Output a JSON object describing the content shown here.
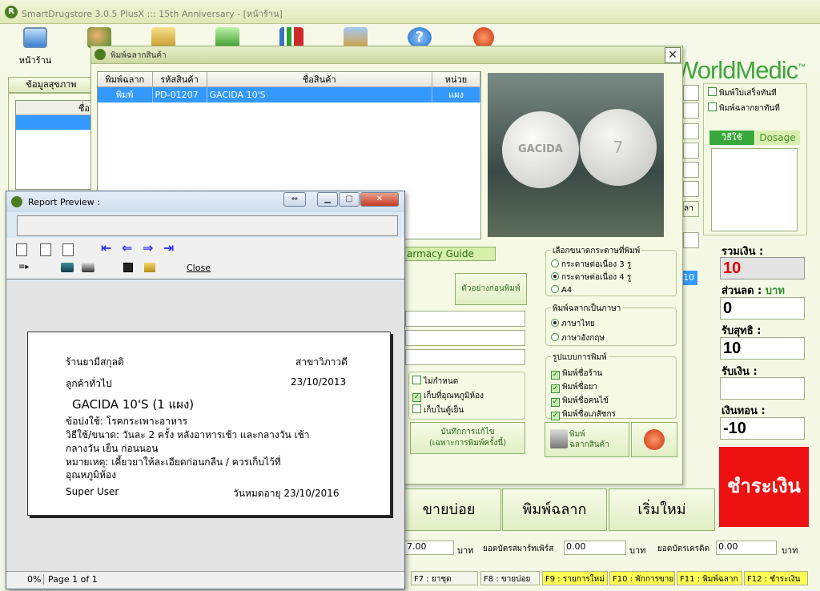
{
  "app": {
    "title": "SmartDrugstore 3.0.5 PlusX ::: 15th Anniversary - [หน้าร้าน]",
    "brand": "WorldMedic",
    "brand_tm": "™"
  },
  "toolbar": {
    "items": [
      {
        "label": "หน้าร้าน",
        "icon": "computer-icon"
      },
      {
        "label": "",
        "icon": "users-icon"
      },
      {
        "label": "",
        "icon": "box-icon"
      },
      {
        "label": "",
        "icon": "refresh-icon"
      },
      {
        "label": "",
        "icon": "chart-icon"
      },
      {
        "label": "",
        "icon": "tools-icon"
      },
      {
        "label": "",
        "icon": "help-icon"
      },
      {
        "label": "",
        "icon": "power-icon"
      }
    ]
  },
  "main": {
    "tab_health": "ข้อมูลสุขภาพ",
    "name_col": "ชื่อ",
    "pharmacy_guide": "armacy Guide",
    "preview_btn": "ตัวอย่างก่อนพิมพ์",
    "checks": [
      {
        "label": "ไม่กำหนด",
        "on": false
      },
      {
        "label": "เก็บที่อุณหภูมิห้อง",
        "on": true
      },
      {
        "label": "เก็บในตู้เย็น",
        "on": false
      }
    ],
    "save_btn_l1": "บันทึกการแก้ไข",
    "save_btn_l2": "(เฉพาะการพิมพ์ครั้งนี้)",
    "right_checks": [
      {
        "label": "พิมพ์ใบเสร็จทันที"
      },
      {
        "label": "พิมพ์ฉลากยาทันที"
      }
    ],
    "tab_howto": "วิธีใช้",
    "tab_dosage": "Dosage",
    "cell_10": "10",
    "cell_la": "ลา",
    "total_label": "รวมเงิน :",
    "total_value": "10",
    "discount_label": "ส่วนลด :",
    "discount_unit": "บาท",
    "discount_value": "0",
    "net_label": "รับสุทธิ :",
    "net_value": "10",
    "received_label": "รับเงิน :",
    "received_value": "",
    "change_label": "เงินทอน :",
    "change_value": "-10",
    "pay_btn": "ชำระเงิน",
    "btn_sell": "ขายบ่อย",
    "btn_print": "พิมพ์ฉลาก",
    "btn_new": "เริ่มใหม่",
    "bottom": {
      "v1": "7.00",
      "u1": "บาท",
      "l2": "ยอดบัตรสมาร์ทเพิร์ส",
      "v2": "0.00",
      "u2": "บาท",
      "l3": "ยอดบัตรเครดิต",
      "v3": "0.00",
      "u3": "บาท"
    },
    "fkeys": [
      "F7 : ยาชุด",
      "F8 : ขายบ่อย",
      "F9 : รายการใหม่",
      "F10 : พักการขาย",
      "F11 : พิมพ์ฉลาก",
      "F12 : ชำระเงิน"
    ]
  },
  "dialog": {
    "title": "พิมพ์ฉลากสินค้า",
    "columns": [
      "พิมพ์ฉลาก",
      "รหัสสินค้า",
      "ชื่อสินค้า",
      "หน่วย"
    ],
    "rows": [
      {
        "print": "พิมพ์",
        "code": "PD-01207",
        "name": "GACIDA 10'S",
        "unit": "แผง"
      }
    ],
    "image_text_l": "GACIDA",
    "image_text_r": "7",
    "paper_title": "เลือกขนาดกระดาษที่พิมพ์",
    "paper": [
      {
        "label": "กระดาษต่อเนื่อง 3 รู",
        "on": false
      },
      {
        "label": "กระดาษต่อเนื่อง 4 รู",
        "on": true
      },
      {
        "label": "A4",
        "on": false
      }
    ],
    "lang_title": "พิมพ์ฉลากเป็นภาษา",
    "lang": [
      {
        "label": "ภาษาไทย",
        "on": true
      },
      {
        "label": "ภาษาอังกฤษ",
        "on": false
      }
    ],
    "format_title": "รูปแบบการพิมพ์",
    "format": [
      {
        "label": "พิมพ์ชื่อร้าน",
        "on": true
      },
      {
        "label": "พิมพ์ชื่อยา",
        "on": true
      },
      {
        "label": "พิมพ์ชื่อคนไข้",
        "on": true
      },
      {
        "label": "พิมพ์ชื่อเภสัชกร",
        "on": true
      }
    ],
    "print_btn_l1": "พิมพ์",
    "print_btn_l2": "ฉลากสินค้า"
  },
  "report": {
    "title": "Report Preview :",
    "close": "Close",
    "status_pct": "0%",
    "status_page": "Page 1 of 1",
    "label": {
      "shop": "ร้านยามีสกุลดิ",
      "branch": "สาขาวิภาวดี",
      "customer": "ลูกค้าทั่วไป",
      "date": "23/10/2013",
      "drug": "GACIDA 10'S (1 แผง)",
      "indication": "ข้อบ่งใช้: โรคกระเพาะอาหาร",
      "usage1": "วิธีใช้/ขนาด: วันละ 2 ครั้ง หลังอาหารเช้า และกลางวัน เช้า",
      "usage2": "กลางวัน เย็น ก่อนนอน",
      "note1": "หมายเหตุ: เคี้ยวยาให้ละเอียดก่อนกลืน / ควรเก็บไว้ที่",
      "note2": "อุณหภูมิห้อง",
      "user": "Super User",
      "expiry": "วันหมดอายุ 23/10/2016"
    }
  }
}
